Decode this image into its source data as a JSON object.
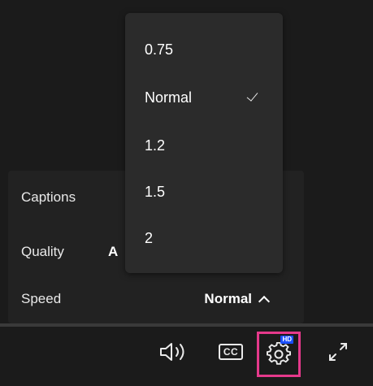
{
  "speed_menu": {
    "options": [
      "0.75",
      "Normal",
      "1.2",
      "1.5",
      "2"
    ],
    "selected": "Normal"
  },
  "settings": {
    "captions_label": "Captions",
    "quality_label": "Quality",
    "quality_value": "A",
    "speed_label": "Speed",
    "speed_value": "Normal"
  },
  "controls": {
    "cc_label": "CC",
    "hd_badge": "HD",
    "icons": [
      "volume-icon",
      "cc-icon",
      "gear-icon",
      "fullscreen-icon"
    ],
    "highlight_color": "#e5398b",
    "hd_badge_color": "#1a4fff"
  }
}
